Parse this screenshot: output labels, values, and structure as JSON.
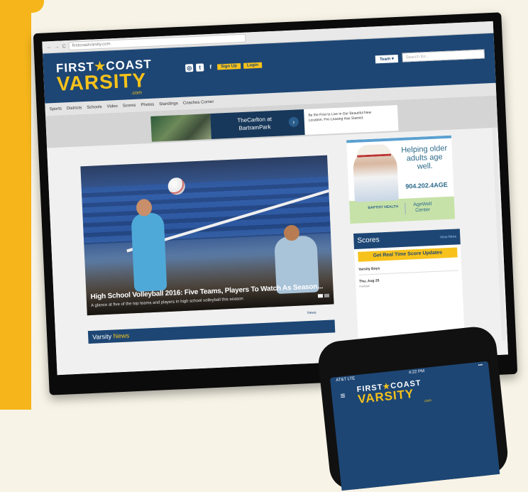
{
  "browser": {
    "url": "firstcoastvarsity.com",
    "back": "←",
    "forward": "→",
    "reload": "C"
  },
  "site": {
    "logo_top": "FIRST",
    "logo_star": "★",
    "logo_top2": "COAST",
    "logo_main": "VARSITY",
    "logo_com": ".com",
    "signup": "Sign Up",
    "login": "Login",
    "team": "Team ▾",
    "search_placeholder": "Search for..."
  },
  "nav": [
    "Sports",
    "Districts",
    "Schools",
    "Video",
    "Scores",
    "Photos",
    "Standings",
    "Coaches Corner"
  ],
  "ad_banner": {
    "title": "TheCarlton at BartramPark",
    "text": "Be the First to Live in Our Beautiful New Location. Pre-Leasing Has Started."
  },
  "hero": {
    "title": "High School Volleyball 2016: Five Teams, Players To Watch As Season...",
    "subtitle": "A glance at five of the top teams and players in high school volleyball this season"
  },
  "news": {
    "title": "Varsity",
    "title_accent": "News",
    "more": "News"
  },
  "side_ad": {
    "headline": "Helping older adults age well.",
    "phone": "904.202.4AGE",
    "brand": "BAPTIST HEALTH",
    "program": "AgeWell Center"
  },
  "scores": {
    "title": "Scores",
    "view_more": "View More",
    "button": "Get Real Time Score Updates",
    "category": "Varsity Boys",
    "date": "Thu, Aug 25",
    "sport": "Football"
  },
  "phone": {
    "carrier": "AT&T  LTE",
    "time": "4:22 PM",
    "battery": "▪▪▪",
    "logo_top": "FIRST",
    "logo_top2": "COAST",
    "logo_main": "VARSITY",
    "logo_com": ".com"
  },
  "colors": {
    "brand_navy": "#1d4674",
    "brand_gold": "#f7c21b",
    "page_bg_accent": "#f5b51b"
  }
}
